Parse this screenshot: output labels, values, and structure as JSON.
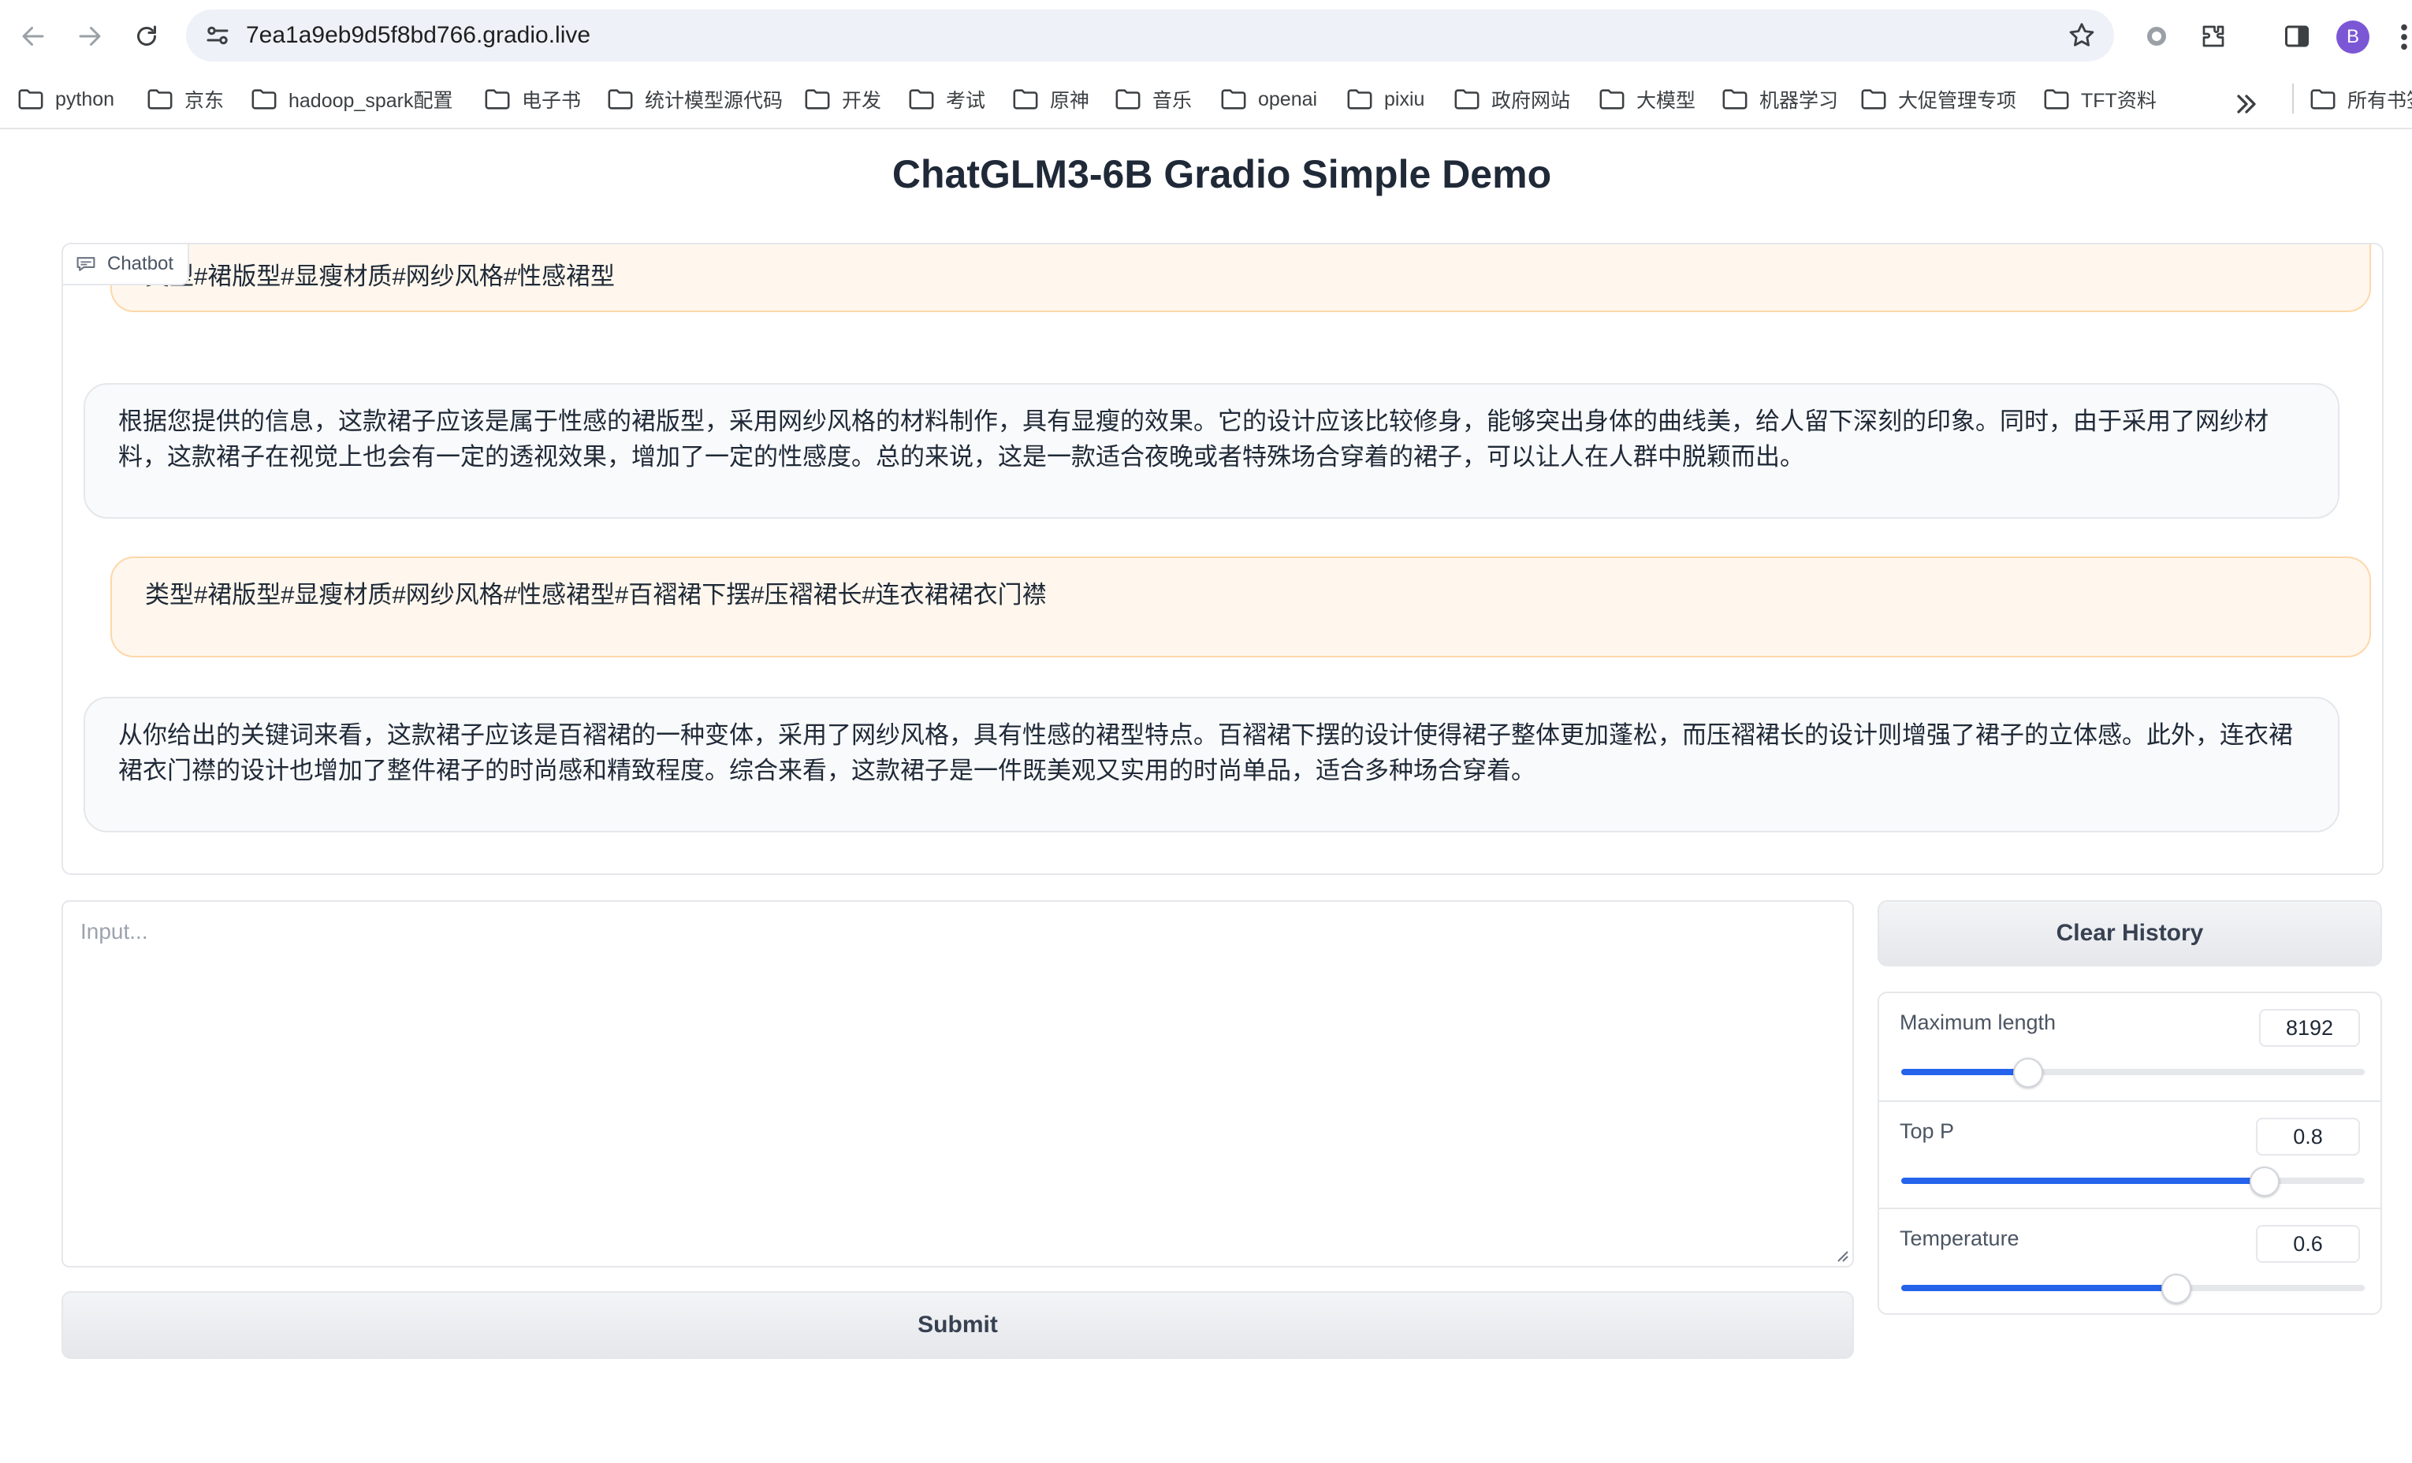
{
  "browser": {
    "url": "7ea1a9eb9d5f8bd766.gradio.live",
    "profile_initial": "B",
    "bookmarks": [
      "python",
      "京东",
      "hadoop_spark配置",
      "电子书",
      "统计模型源代码",
      "开发",
      "考试",
      "原神",
      "音乐",
      "openai",
      "pixiu",
      "政府网站",
      "大模型",
      "机器学习",
      "大促管理专项",
      "TFT资料"
    ],
    "bookmarks_overflow": "所有书签"
  },
  "app": {
    "title": "ChatGLM3-6B Gradio Simple Demo",
    "chatbot_label": "Chatbot",
    "messages": [
      {
        "role": "user",
        "text": "类型#裙版型#显瘦材质#网纱风格#性感裙型"
      },
      {
        "role": "bot",
        "text": "根据您提供的信息，这款裙子应该是属于性感的裙版型，采用网纱风格的材料制作，具有显瘦的效果。它的设计应该比较修身，能够突出身体的曲线美，给人留下深刻的印象。同时，由于采用了网纱材料，这款裙子在视觉上也会有一定的透视效果，增加了一定的性感度。总的来说，这是一款适合夜晚或者特殊场合穿着的裙子，可以让人在人群中脱颖而出。"
      },
      {
        "role": "user",
        "text": "类型#裙版型#显瘦材质#网纱风格#性感裙型#百褶裙下摆#压褶裙长#连衣裙裙衣门襟"
      },
      {
        "role": "bot",
        "text": "从你给出的关键词来看，这款裙子应该是百褶裙的一种变体，采用了网纱风格，具有性感的裙型特点。百褶裙下摆的设计使得裙子整体更加蓬松，而压褶裙长的设计则增强了裙子的立体感。此外，连衣裙裙衣门襟的设计也增加了整件裙子的时尚感和精致程度。综合来看，这款裙子是一件既美观又实用的时尚单品，适合多种场合穿着。"
      }
    ],
    "input_placeholder": "Input...",
    "input_value": "",
    "submit_label": "Submit",
    "clear_label": "Clear History",
    "sliders": [
      {
        "label": "Maximum length",
        "value": "8192",
        "fraction": 0.27
      },
      {
        "label": "Top P",
        "value": "0.8",
        "fraction": 0.78
      },
      {
        "label": "Temperature",
        "value": "0.6",
        "fraction": 0.59
      }
    ]
  },
  "colors": {
    "accent": "#2563eb",
    "user_bubble": "#fff7ed",
    "bot_bubble": "#f9fafb"
  }
}
